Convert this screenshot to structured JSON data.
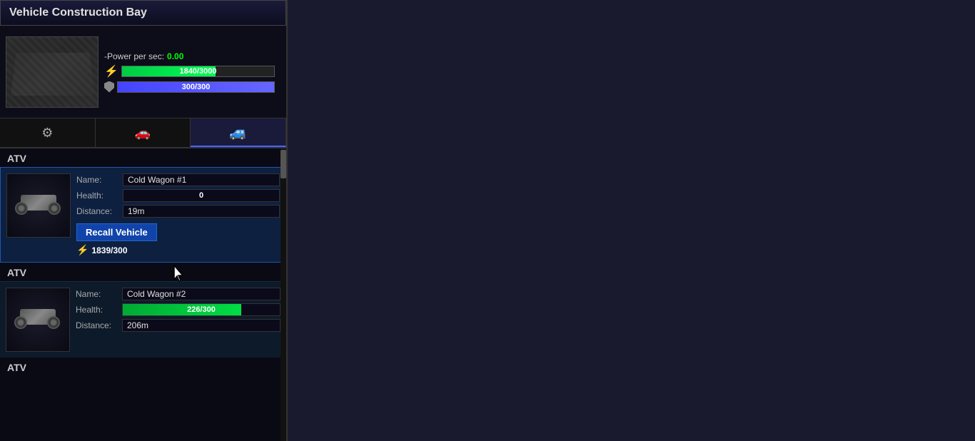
{
  "panel": {
    "title": "Vehicle Construction Bay",
    "preview": {
      "power_label": "-Power per sec:",
      "power_value": "0.00",
      "energy_bar": "1840/3000",
      "shield_bar": "300/300"
    },
    "tabs": [
      {
        "id": "settings",
        "icon": "⚙",
        "active": false
      },
      {
        "id": "vehicle",
        "icon": "🚗",
        "active": false
      },
      {
        "id": "garage",
        "icon": "🚙",
        "active": true
      }
    ],
    "vehicles": [
      {
        "section_label": "ATV",
        "name": "Cold Wagon #1",
        "health_value": "0",
        "health_percent": 0,
        "distance": "19m",
        "recall_label": "Recall Vehicle",
        "power_cost": "1839/300",
        "highlighted": true
      },
      {
        "section_label": "ATV",
        "name": "Cold Wagon #2",
        "health_value": "226/300",
        "health_percent": 75.3,
        "distance": "206m",
        "highlighted": false
      },
      {
        "section_label": "ATV",
        "name": "",
        "health_value": "",
        "health_percent": 0,
        "distance": "",
        "highlighted": false
      }
    ]
  }
}
